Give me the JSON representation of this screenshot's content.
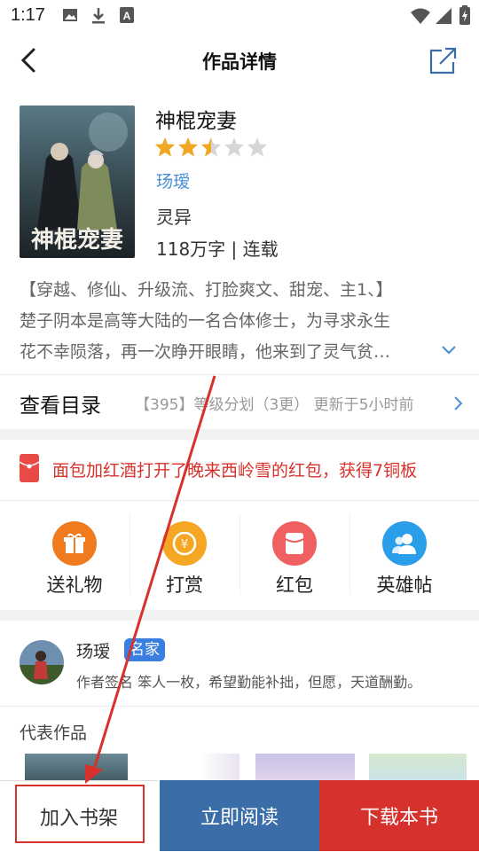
{
  "status_bar": {
    "time": "1:17"
  },
  "nav": {
    "title": "作品详情"
  },
  "book": {
    "title": "神棍宠妻",
    "rating": 2.5,
    "rating_max": 5,
    "author": "玚瑷",
    "genre": "灵异",
    "meta": "118万字 | 连载",
    "cover_text": "神棍宠妻",
    "description": [
      "【穿越、修仙、升级流、打脸爽文、甜宠、主1、】",
      "楚子阴本是高等大陆的一名合体修士，为寻求永生",
      "花不幸陨落，再一次睁开眼睛，他来到了灵气贫…"
    ]
  },
  "catalog": {
    "label": "查看目录",
    "latest": "【395】等级分划（3更）  更新于5小时前"
  },
  "red_envelope": {
    "text": "面包加红酒打开了晚来西岭雪的红包，获得7铜板"
  },
  "actions": [
    {
      "label": "送礼物",
      "icon": "gift-icon",
      "color": "#f07a1e"
    },
    {
      "label": "打赏",
      "icon": "coin-icon",
      "color": "#f5a623"
    },
    {
      "label": "红包",
      "icon": "red-packet-icon",
      "color": "#f06060"
    },
    {
      "label": "英雄帖",
      "icon": "fans-icon",
      "color": "#2a9ee8"
    }
  ],
  "author_card": {
    "name": "玚瑷",
    "badge": "名家",
    "signature": "作者签名  笨人一枚，希望勤能补拙，但愿，天道酬勤。"
  },
  "representative": {
    "title": "代表作品"
  },
  "bottom_bar": {
    "add_shelf": "加入书架",
    "read_now": "立即阅读",
    "download": "下载本书"
  },
  "colors": {
    "primary_blue": "#3b6ea8",
    "primary_red": "#d6312c",
    "link_blue": "#4a8fd8"
  }
}
